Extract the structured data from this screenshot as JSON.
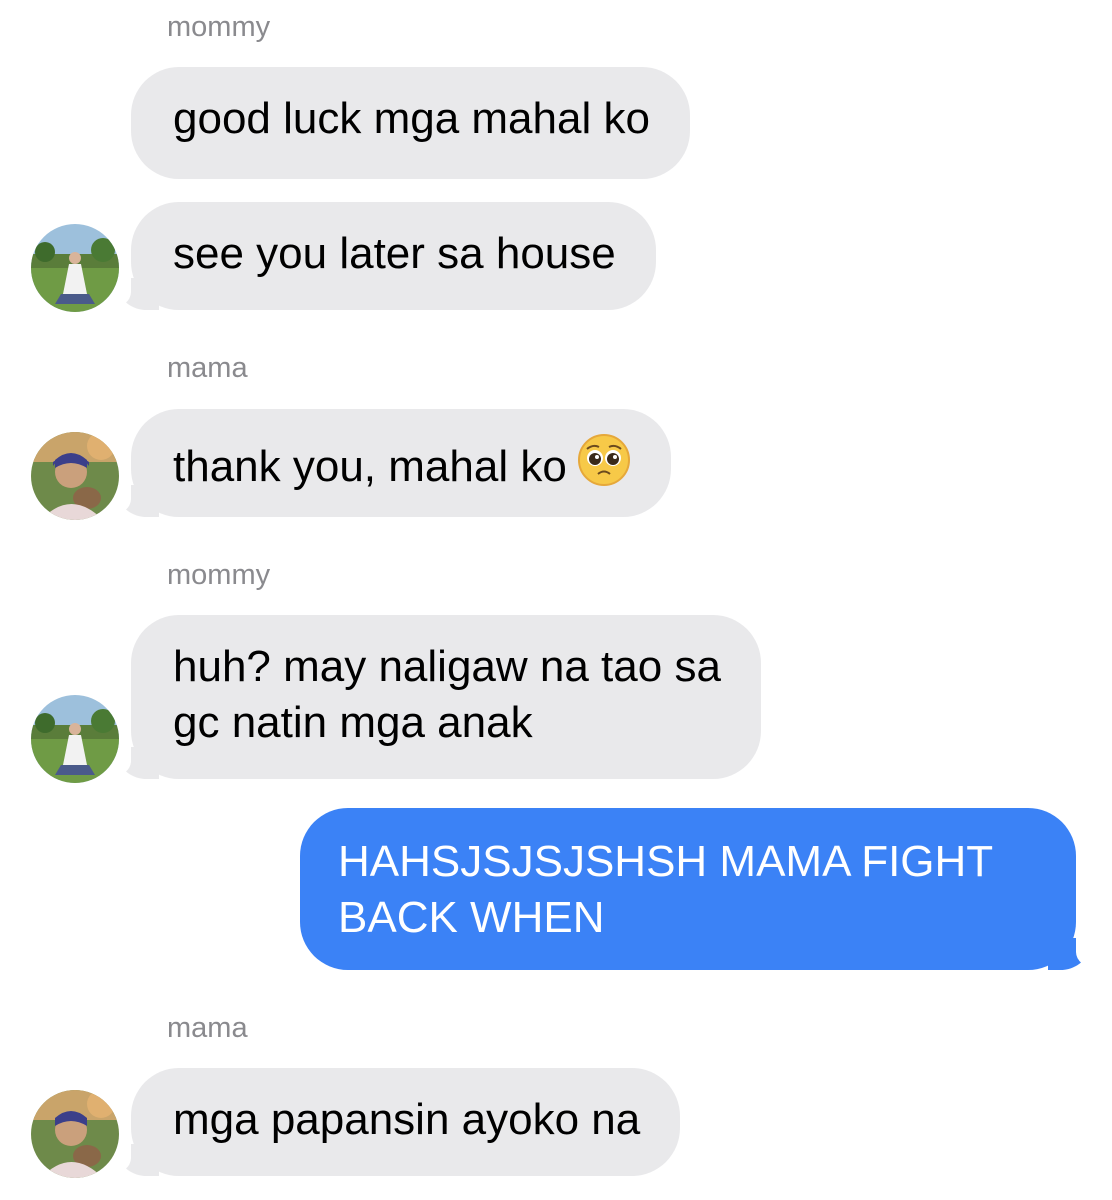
{
  "thread": {
    "messages": [
      {
        "sender": "mommy",
        "text": "good luck mga mahal ko"
      },
      {
        "text": "see you later sa house"
      },
      {
        "sender": "mama",
        "text": "thank you, mahal ko",
        "emoji": "pleading-face-emoji"
      },
      {
        "sender": "mommy",
        "line1": "huh? may naligaw na tao sa",
        "line2": "gc natin mga anak"
      },
      {
        "line1": "HAHSJSJSJSHSH MAMA FIGHT",
        "line2": "BACK WHEN"
      },
      {
        "sender": "mama",
        "text": "mga papansin ayoko na"
      }
    ]
  },
  "colors": {
    "incoming_bubble": "#e9e9eb",
    "outgoing_bubble": "#3b82f6",
    "sender_label": "#8a8a8e",
    "background": "#ffffff"
  },
  "icons": {
    "mommy_avatar": "mommy-avatar-photo",
    "mama_avatar": "mama-avatar-photo"
  }
}
